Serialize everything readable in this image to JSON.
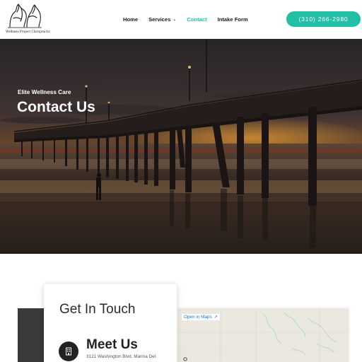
{
  "header": {
    "logo": {
      "text": "Wellness Project Chiropractic",
      "icon": "horse-logo-icon"
    },
    "nav": [
      {
        "label": "Home",
        "active": false,
        "dropdown": false
      },
      {
        "label": "Services",
        "active": false,
        "dropdown": true
      },
      {
        "label": "Contact",
        "active": true,
        "dropdown": false
      },
      {
        "label": "Intake Form",
        "active": false,
        "dropdown": false
      }
    ],
    "phone_button": "(310) 266-2980"
  },
  "hero": {
    "kicker": "Elite Wellness Care",
    "title": "Contact Us"
  },
  "contact": {
    "card_title": "Get In Touch",
    "meet": {
      "icon": "building-icon",
      "title": "Meet Us",
      "address": "3121 Washington Blvd, Marina Del"
    },
    "map": {
      "link_label": "Open in Maps",
      "link_icon": "external-link-icon"
    }
  },
  "colors": {
    "accent": "#21bfa3",
    "active_nav": "#21c3a6",
    "dark_block": "#3a3a3a"
  }
}
